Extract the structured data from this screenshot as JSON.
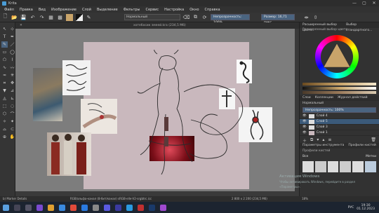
{
  "window": {
    "title": "Krita",
    "minimize": "—",
    "maximize": "▢",
    "close": "✕"
  },
  "menu": [
    "Файл",
    "Правка",
    "Вид",
    "Изображение",
    "Слой",
    "Выделение",
    "Фильтры",
    "Сервис",
    "Настройка",
    "Окно",
    "Справка"
  ],
  "toolbar": {
    "brush_preset": "Нормальный",
    "opacity_label": "Непрозрачность: 100%",
    "size_label": "Размер: 16,71 пикс"
  },
  "document": {
    "tab_title": "хотебосик змеей.kra (234,5 Мб)",
    "tab_close": "✕"
  },
  "right_panel": {
    "tabs": [
      "Расширенный выбор цвета",
      "Выбор стандартного..."
    ],
    "advanced_color_title": "Расширенный выбор цвета",
    "sub_tabs": [
      "Слои",
      "Коллекции",
      "Журнал действий"
    ],
    "blend_mode": "Нормальный",
    "layer_opacity": "Непрозрачность: 100%",
    "layers": [
      {
        "name": "Слой 4"
      },
      {
        "name": "Слой 5"
      },
      {
        "name": "Слой 3"
      },
      {
        "name": "Слой 1"
      }
    ],
    "brush_tabs": [
      "Параметры инструмента",
      "Профили кистей"
    ],
    "brush_profiles_label": "Профили кистей",
    "brush_filter": "Все",
    "brush_tag": "Метки"
  },
  "status": {
    "left": "b) Marker Details",
    "color_info": "RGB/альфа-канал (8-бит/канал)  sRGB-elle-V2-srgbtrc.icc",
    "dimensions": "2 800 x 2 200 (234,5 Мб)",
    "zoom": "18%"
  },
  "watermark": {
    "line1": "Активация Windows",
    "line2": "Чтобы активировать Windows, перейдите в раздел «Параметры»."
  },
  "taskbar": {
    "lang": "РУС",
    "time": "19:30",
    "date": "01.12.2023"
  },
  "colors": {
    "accent": "#3b5a7a",
    "page": "#c9b8bd",
    "canvas_bg": "#7d7d7d"
  }
}
